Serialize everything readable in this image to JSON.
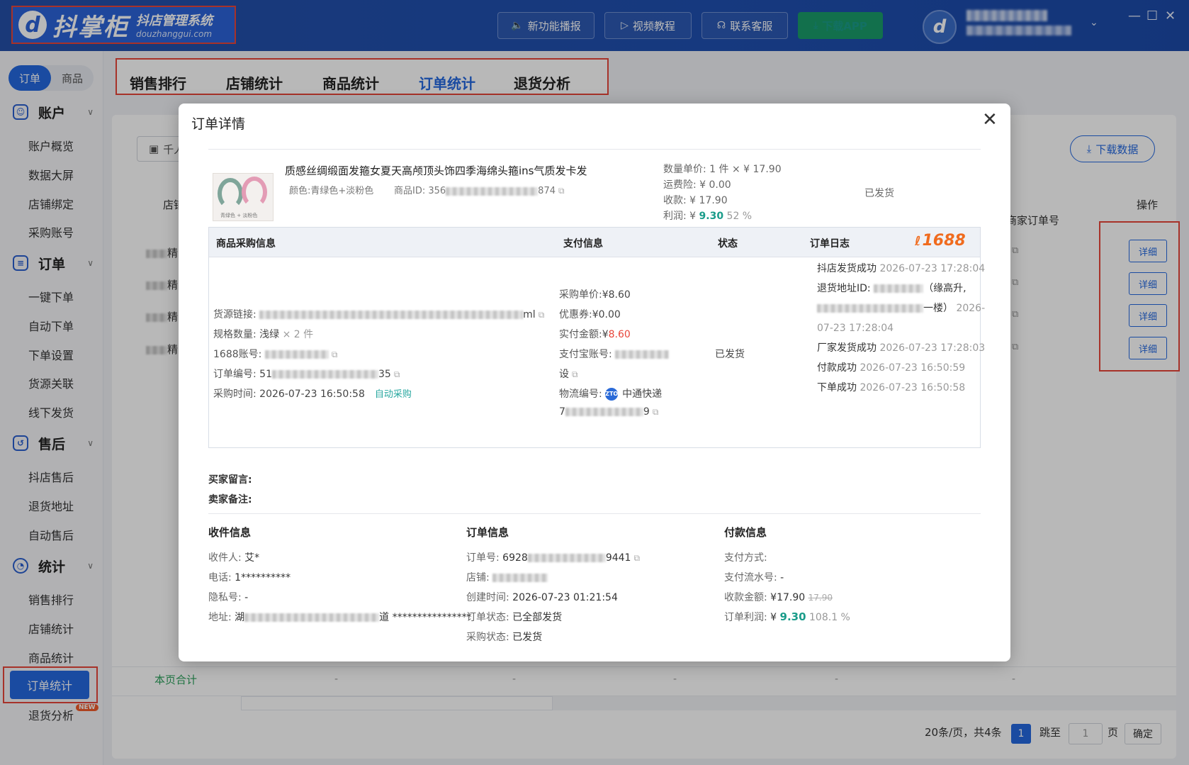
{
  "header": {
    "logo_name": "抖掌柜",
    "logo_sub": "抖店管理系统",
    "logo_domain": "douzhanggui.com",
    "buttons": {
      "news": "新功能播报",
      "video": "视频教程",
      "support": "联系客服",
      "download_app": "下载APP"
    }
  },
  "sidebar": {
    "seg_order": "订单",
    "seg_product": "商品",
    "sections": [
      {
        "label": "账户",
        "items": [
          "账户概览",
          "数据大屏",
          "店铺绑定",
          "采购账号"
        ]
      },
      {
        "label": "订单",
        "items": [
          "一键下单",
          "自动下单",
          "下单设置",
          "货源关联",
          "线下发货"
        ]
      },
      {
        "label": "售后",
        "items": [
          "抖店售后",
          "退货地址",
          "自动售后"
        ]
      },
      {
        "label": "统计",
        "items": [
          "销售排行",
          "店铺统计",
          "商品统计",
          "订单统计",
          "退货分析"
        ]
      }
    ],
    "new_badge": "NEW"
  },
  "tabs": [
    "销售排行",
    "店铺统计",
    "商品统计",
    "订单统计",
    "退货分析"
  ],
  "main": {
    "shop_select": "千人",
    "download_data": "下载数据",
    "col_shop": "店铺",
    "col_merchant_order": "商家订单号",
    "col_op": "操作",
    "row_prefix": "精",
    "detail_label": "详细",
    "footer_label": "本页合计",
    "footer_dash": "-",
    "pager_info": "20条/页，共4条",
    "page_current": "1",
    "jump_to": "跳至",
    "jump_value": "1",
    "page_unit": "页",
    "confirm": "确定"
  },
  "modal": {
    "title": "订单详情",
    "product": {
      "title": "质感丝绸缎面发箍女夏天高颅顶头饰四季海绵头箍ins气质发卡发",
      "attr": "颜色:青绿色+淡粉色",
      "id_prefix": "商品ID: 356",
      "id_suffix": "874",
      "img_caption": "青绿色  +  淡粉色",
      "qty_price_label": "数量单价:",
      "qty_price": "1 件 × ¥ 17.90",
      "shipping_ins_label": "运费险:",
      "shipping_ins": "¥ 0.00",
      "collected_label": "收款:",
      "collected": "¥ 17.90",
      "profit_label": "利润:",
      "profit_prefix": "¥",
      "profit": "9.30",
      "profit_pct": "52 %",
      "status": "已发货"
    },
    "table": {
      "headers": [
        "商品采购信息",
        "支付信息",
        "状态",
        "订单日志"
      ],
      "brand": "1688",
      "purchase": {
        "source_label": "货源链接:",
        "source_tail": "ml",
        "spec_label": "规格数量:",
        "spec": "浅绿",
        "spec_qty": "× 2 件",
        "account_label": "1688账号:",
        "order_no_label": "订单编号:",
        "order_no_head": "51",
        "order_no_tail": "35",
        "time_label": "采购时间:",
        "time": "2026-07-23 16:50:58",
        "auto": "自动采购"
      },
      "payment": {
        "unit_label": "采购单价:",
        "unit": "¥8.60",
        "coupon_label": "优惠券:",
        "coupon": "¥0.00",
        "paid_label": "实付金额:",
        "paid_prefix": "¥",
        "paid": "8.60",
        "alipay_label": "支付宝账号:",
        "alipay_tail": "设",
        "logistics_label": "物流编号:",
        "carrier": "中通快递",
        "carrier_icon": "ZTO",
        "tracking_head": "7",
        "tracking_tail": "9"
      },
      "status": "已发货",
      "log": [
        {
          "text": "抖店发货成功",
          "time": "2026-07-23 17:28:04"
        },
        {
          "text": "退货地址ID:",
          "extra_head": "（缘高升,",
          "extra_tail": "一楼）",
          "time": "2026-07-23 17:28:04"
        },
        {
          "text": "厂家发货成功",
          "time": "2026-07-23 17:28:03"
        },
        {
          "text": "付款成功",
          "time": "2026-07-23 16:50:59"
        },
        {
          "text": "下单成功",
          "time": "2026-07-23 16:50:58"
        }
      ]
    },
    "buyer_msg_label": "买家留言:",
    "seller_note_label": "卖家备注:",
    "receiver": {
      "heading": "收件信息",
      "name_label": "收件人:",
      "name": "艾*",
      "phone_label": "电话:",
      "phone": "1**********",
      "privacy_label": "隐私号:",
      "privacy": "-",
      "address_label": "地址:",
      "address_head": "湖",
      "address_tail": "道 ****************"
    },
    "order": {
      "heading": "订单信息",
      "no_label": "订单号:",
      "no_head": "6928",
      "no_tail": "9441",
      "shop_label": "店铺:",
      "created_label": "创建时间:",
      "created": "2026-07-23 01:21:54",
      "status_label": "订单状态:",
      "status": "已全部发货",
      "purchase_label": "采购状态:",
      "purchase_status": "已发货"
    },
    "pay": {
      "heading": "付款信息",
      "method_label": "支付方式:",
      "method": "",
      "serial_label": "支付流水号:",
      "serial": "-",
      "amount_label": "收款金额:",
      "amount": "¥17.90",
      "amount_strike": "17.90",
      "profit_label": "订单利润:",
      "profit_prefix": "¥",
      "profit": "9.30",
      "profit_pct": "108.1 %"
    }
  },
  "colors": {
    "primary": "#2468e0",
    "header_bg": "#1f4fb0",
    "highlight_border": "#e8463a",
    "profit_green": "#1a9c8a",
    "brand_1688": "#f06b1e"
  }
}
